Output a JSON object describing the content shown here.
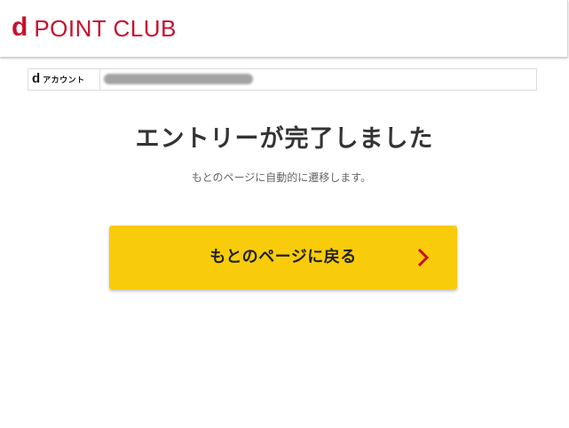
{
  "header": {
    "logo_d": "d",
    "logo_text": "POINT CLUB",
    "brand_color": "#c8102e"
  },
  "account": {
    "logo_d": "d",
    "label": "アカウント",
    "value_masked": true
  },
  "main": {
    "title": "エントリーが完了しました",
    "subtitle": "もとのページに自動的に遷移します。",
    "back_button_label": "もとのページに戻る",
    "back_button_color": "#f8cc0a",
    "chevron_color": "#c8102e",
    "chevron_icon": "chevron-right-icon"
  }
}
